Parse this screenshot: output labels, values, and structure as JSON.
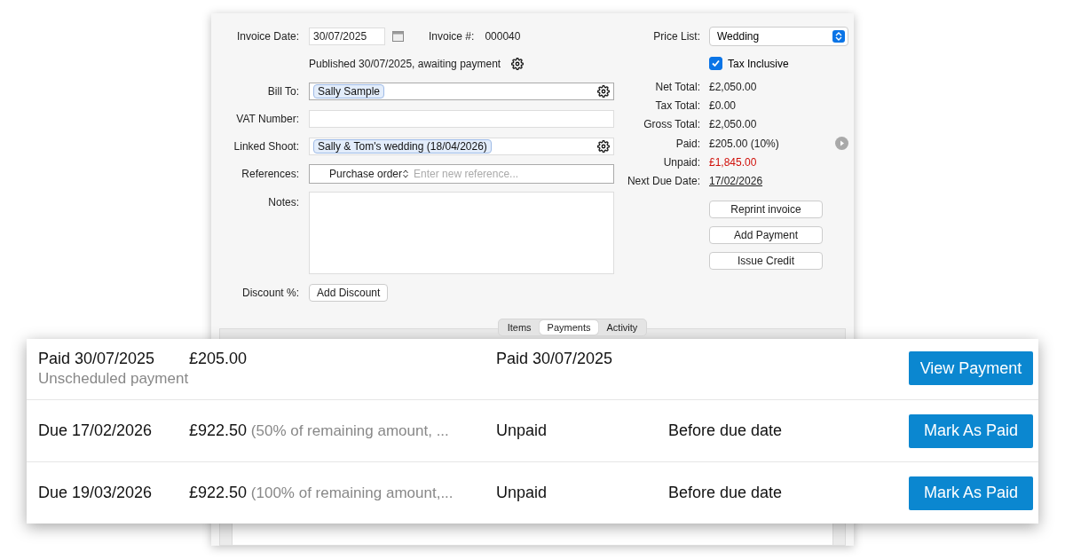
{
  "invoice_date": {
    "label": "Invoice Date:",
    "value": "30/07/2025"
  },
  "invoice_number": {
    "label": "Invoice #:",
    "value": "000040"
  },
  "status": "Published 30/07/2025, awaiting payment",
  "bill_to": {
    "label": "Bill To:",
    "token": "Sally Sample"
  },
  "vat_number": {
    "label": "VAT Number:"
  },
  "linked_shoot": {
    "label": "Linked Shoot:",
    "token": "Sally & Tom's wedding (18/04/2026)"
  },
  "references": {
    "label": "References:",
    "type": "Purchase order",
    "placeholder": "Enter new reference..."
  },
  "notes": {
    "label": "Notes:"
  },
  "discount": {
    "label": "Discount %:",
    "button": "Add Discount"
  },
  "price_list": {
    "label": "Price List:",
    "value": "Wedding"
  },
  "tax_inclusive": {
    "label": "Tax Inclusive",
    "checked": true
  },
  "totals": [
    {
      "label": "Net Total:",
      "value": "£2,050.00",
      "kind": "plain"
    },
    {
      "label": "Tax Total:",
      "value": "£0.00",
      "kind": "plain"
    },
    {
      "label": "Gross Total:",
      "value": "£2,050.00",
      "kind": "plain"
    },
    {
      "label": "Paid:",
      "value": "£205.00 (10%)",
      "kind": "paid"
    },
    {
      "label": "Unpaid:",
      "value": "£1,845.00",
      "kind": "alert"
    },
    {
      "label": "Next Due Date:",
      "value": "17/02/2026",
      "kind": "date"
    }
  ],
  "actions": [
    "Reprint invoice",
    "Add Payment",
    "Issue Credit"
  ],
  "tabs": [
    {
      "label": "Items",
      "selected": false
    },
    {
      "label": "Payments",
      "selected": true
    },
    {
      "label": "Activity",
      "selected": false
    }
  ],
  "payments": [
    {
      "date": "Paid 30/07/2025",
      "amount": "£205.00",
      "note": "Unscheduled payment",
      "kind": "unscheduled",
      "status": "Paid 30/07/2025",
      "action": "View Payment"
    },
    {
      "date": "Due 17/02/2026",
      "amount": "£922.50",
      "note": "(50% of remaining amount, ...",
      "kind": "scheduled",
      "status": "Unpaid",
      "timing": "Before due date",
      "action": "Mark As Paid"
    },
    {
      "date": "Due 19/03/2026",
      "amount": "£922.50",
      "note": "(100% of remaining amount,...",
      "kind": "scheduled",
      "status": "Unpaid",
      "timing": "Before due date",
      "action": "Mark As Paid"
    }
  ]
}
